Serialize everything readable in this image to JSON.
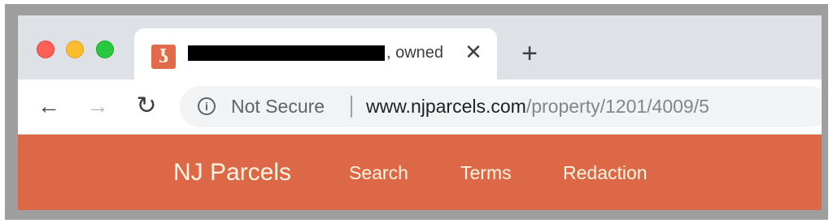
{
  "window": {
    "controls": [
      "close",
      "minimize",
      "zoom"
    ],
    "control_colors": {
      "close": "#fe5f57",
      "minimize": "#febc2e",
      "zoom": "#28c840"
    }
  },
  "tab": {
    "favicon_icon": "nj-parcels-logo-icon",
    "favicon_color": "#e06a4a",
    "title_visible": ", owned",
    "title_redacted": true,
    "close_glyph": "✕"
  },
  "new_tab": {
    "glyph": "+"
  },
  "toolbar": {
    "back_glyph": "←",
    "forward_glyph": "→",
    "reload_glyph": "↻",
    "forward_enabled": false
  },
  "omnibox": {
    "info_glyph": "i",
    "security_label": "Not Secure",
    "url_host": "www.njparcels.com",
    "url_path": "/property/1201/4009/5"
  },
  "site_nav": {
    "background_color": "#dd6847",
    "text_color": "#fff6e3",
    "brand": "NJ Parcels",
    "links": [
      {
        "label": "Search"
      },
      {
        "label": "Terms"
      },
      {
        "label": "Redaction"
      }
    ]
  }
}
